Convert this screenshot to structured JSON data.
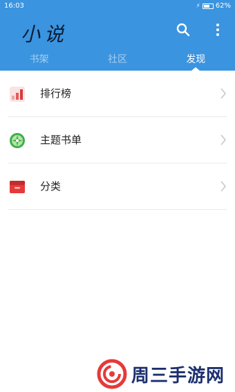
{
  "status": {
    "time": "16:03",
    "battery": "62%"
  },
  "app": {
    "title": "小说"
  },
  "tabs": [
    {
      "label": "书架",
      "active": false
    },
    {
      "label": "社区",
      "active": false
    },
    {
      "label": "发现",
      "active": true
    }
  ],
  "menu": [
    {
      "label": "排行榜",
      "icon": "ranking-chart-icon"
    },
    {
      "label": "主题书单",
      "icon": "green-ball-icon"
    },
    {
      "label": "分类",
      "icon": "red-box-icon"
    }
  ],
  "watermark": {
    "text": "周三手游网"
  },
  "colors": {
    "header": "#3a94df",
    "accent_red": "#e53a3a",
    "green": "#3daf4a"
  }
}
